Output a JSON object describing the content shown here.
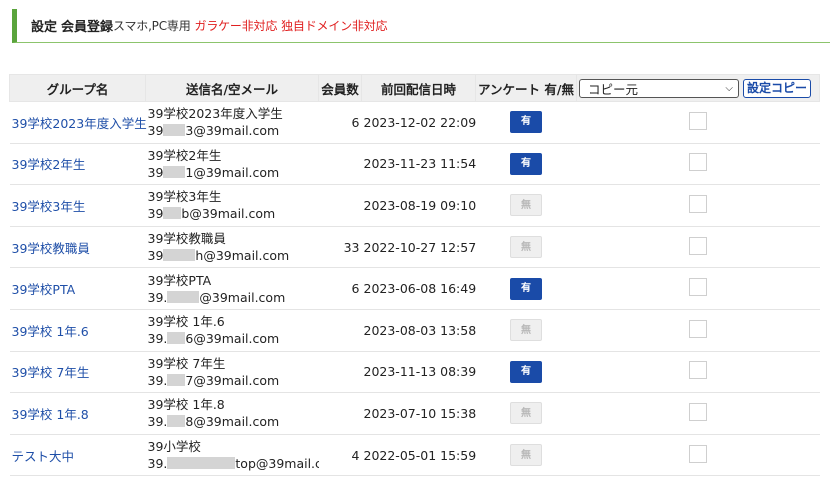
{
  "header": {
    "title": "設定",
    "subtitle": "会員登録",
    "note": "スマホ,PC専用",
    "warning1": "ガラケー非対応",
    "warning2": "独自ドメイン非対応"
  },
  "table": {
    "columns": {
      "group": "グループ名",
      "sender": "送信名/空メール",
      "count": "会員数",
      "last_sent": "前回配信日時",
      "survey": "アンケート 有/無"
    },
    "copy": {
      "select_value": "コピー元",
      "button_label": "設定コピー"
    },
    "rows": [
      {
        "group": "39学校2023年度入学生",
        "sender": "39学校2023年度入学生",
        "email_prefix": "39",
        "email_suffix": "3@39mail.com",
        "count": "6",
        "last_sent": "2023-12-02 22:09",
        "survey": "有",
        "survey_on": true
      },
      {
        "group": "39学校2年生",
        "sender": "39学校2年生",
        "email_prefix": "39",
        "email_suffix": "1@39mail.com",
        "count": "",
        "last_sent": "2023-11-23 11:54",
        "survey": "有",
        "survey_on": true
      },
      {
        "group": "39学校3年生",
        "sender": "39学校3年生",
        "email_prefix": "39",
        "email_suffix": "b@39mail.com",
        "count": "",
        "last_sent": "2023-08-19 09:10",
        "survey": "無",
        "survey_on": false
      },
      {
        "group": "39学校教職員",
        "sender": "39学校教職員",
        "email_prefix": "39",
        "email_suffix": "h@39mail.com",
        "count": "33",
        "last_sent": "2022-10-27 12:57",
        "survey": "無",
        "survey_on": false
      },
      {
        "group": "39学校PTA",
        "sender": "39学校PTA",
        "email_prefix": "39.",
        "email_suffix": "@39mail.com",
        "count": "6",
        "last_sent": "2023-06-08 16:49",
        "survey": "有",
        "survey_on": true
      },
      {
        "group": "39学校 1年.6",
        "sender": "39学校 1年.6",
        "email_prefix": "39.",
        "email_suffix": "6@39mail.com",
        "count": "",
        "last_sent": "2023-08-03 13:58",
        "survey": "無",
        "survey_on": false
      },
      {
        "group": "39学校 7年生",
        "sender": "39学校 7年生",
        "email_prefix": "39.",
        "email_suffix": "7@39mail.com",
        "count": "",
        "last_sent": "2023-11-13 08:39",
        "survey": "有",
        "survey_on": true
      },
      {
        "group": "39学校 1年.8",
        "sender": "39学校 1年.8",
        "email_prefix": "39.",
        "email_suffix": "8@39mail.com",
        "count": "",
        "last_sent": "2023-07-10 15:38",
        "survey": "無",
        "survey_on": false
      },
      {
        "group": "テスト大中",
        "sender": "39小学校",
        "email_prefix": "39.",
        "email_suffix": "top@39mail.com",
        "count": "4",
        "last_sent": "2022-05-01 15:59",
        "survey": "無",
        "survey_on": false
      }
    ]
  }
}
